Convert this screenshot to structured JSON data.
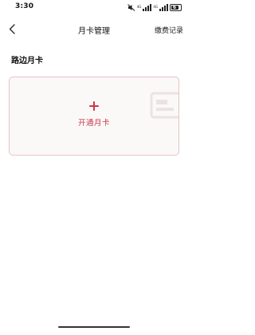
{
  "status_bar": {
    "time": "3:30",
    "network_label": "4G",
    "battery_level": "6",
    "icons": [
      "mute-icon",
      "signal-icon",
      "signal-icon",
      "battery-icon"
    ]
  },
  "nav": {
    "back_icon": "chevron-left-icon",
    "title": "月卡管理",
    "action_label": "缴费记录"
  },
  "main": {
    "section_title": "路边月卡",
    "card": {
      "icon": "plus-icon",
      "label": "开通月卡",
      "watermark_icon": "card-watermark-icon"
    }
  },
  "colors": {
    "accent": "#c8374a",
    "card_border": "#e8c3c6",
    "card_background": "#fbf8f8"
  }
}
